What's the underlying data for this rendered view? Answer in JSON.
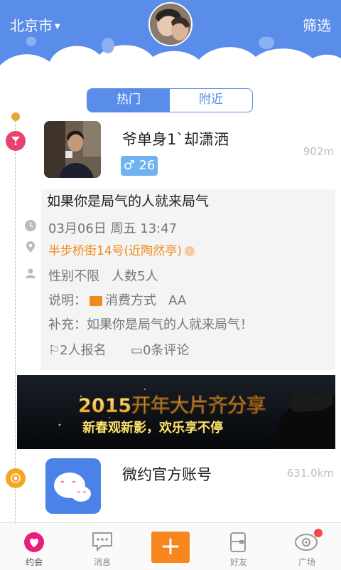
{
  "header": {
    "city": "北京市",
    "filter_label": "筛选",
    "avatar": "user-avatar"
  },
  "tabs": [
    {
      "label": "热门",
      "active": true
    },
    {
      "label": "附近",
      "active": false
    }
  ],
  "posts": [
    {
      "username": "爷单身1`却潇洒",
      "gender_icon": "male-icon",
      "age": "26",
      "distance": "902m",
      "title": "如果你是局气的人就来局气",
      "time": "03月06日 周五 13:47",
      "address": "半步桥街14号(近陶然亭)",
      "gender_limit": "性别不限",
      "count": "人数5人",
      "desc_label": "说明：",
      "pay_text": "消费方式",
      "pay_value": "AA",
      "supplement": "补充：如果你是局气的人就来局气！",
      "signups": "2人报名",
      "comments": "0条评论"
    },
    {
      "username": "微约官方账号",
      "distance": "631.0km"
    }
  ],
  "banner": {
    "title": "2015开年大片齐分享",
    "subtitle": "新春观新影，欢乐享不停"
  },
  "nav": [
    {
      "label": "约会",
      "icon": "heart-icon"
    },
    {
      "label": "消息",
      "icon": "message-icon"
    },
    {
      "label": "",
      "icon": "plus-icon"
    },
    {
      "label": "好友",
      "icon": "friends-icon"
    },
    {
      "label": "广场",
      "icon": "square-icon"
    }
  ],
  "colors": {
    "header": "#5A8CE9",
    "accent": "#F7861C",
    "address": "#F08A1C",
    "nav_active": "#E91E7A"
  }
}
